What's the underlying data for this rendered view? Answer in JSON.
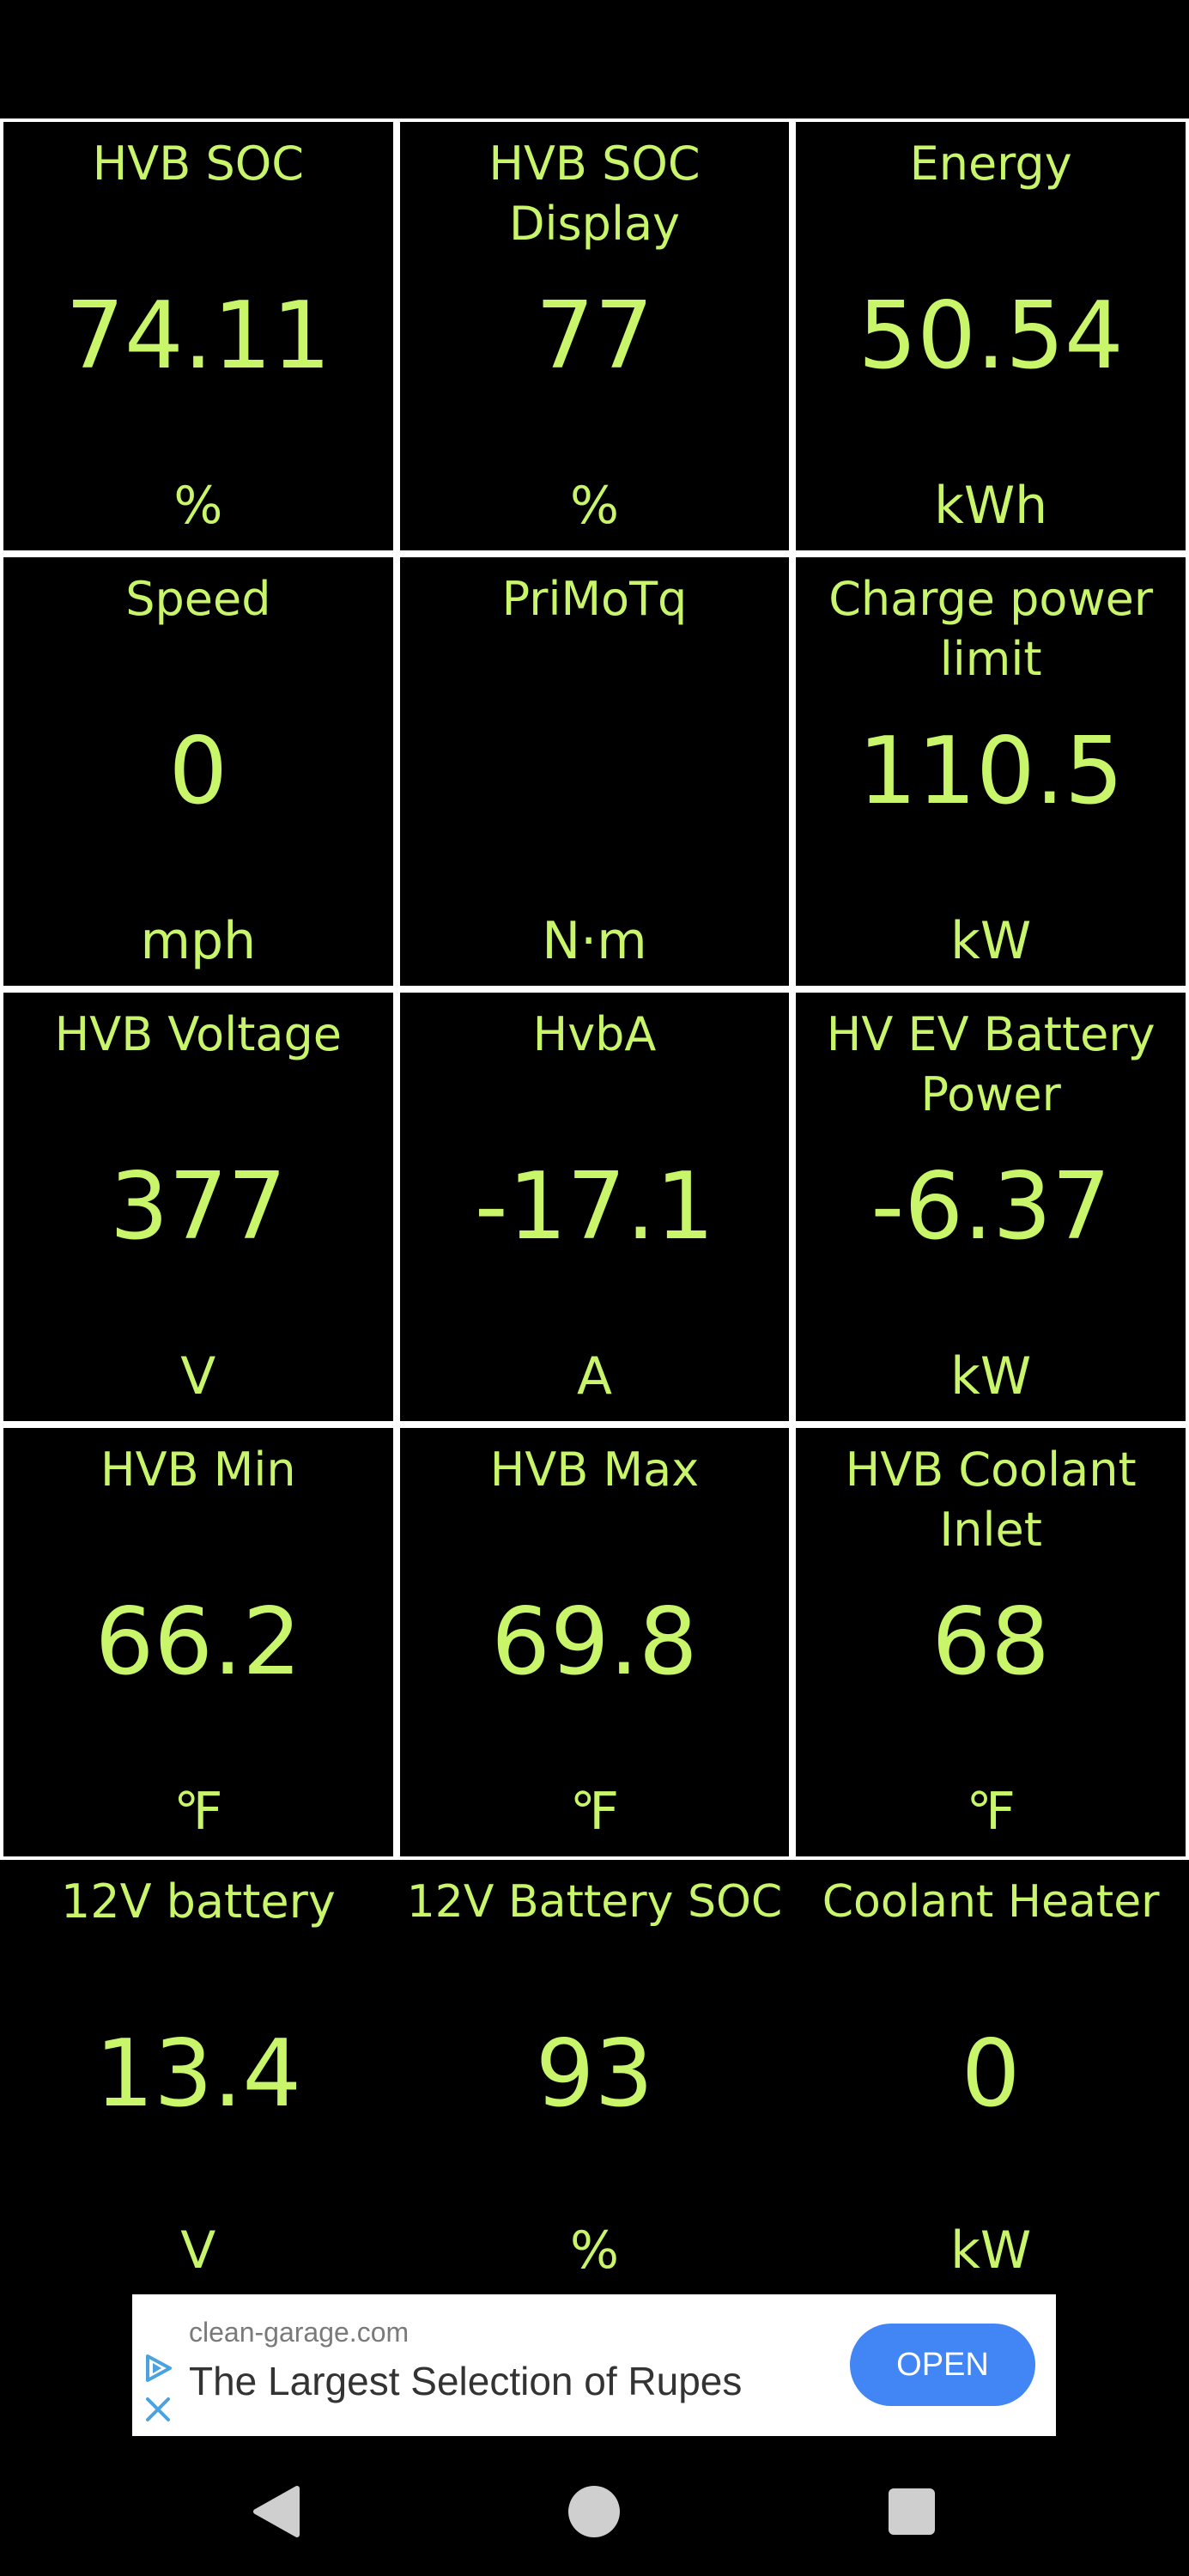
{
  "colors": {
    "background": "#000000",
    "text": "#c8f56a",
    "grid_border": "#ffffff",
    "ad_button": "#4285f4",
    "nav_icon": "#cfcfcf"
  },
  "tiles": [
    {
      "label": "HVB SOC",
      "value": "74.11",
      "unit": "%"
    },
    {
      "label": "HVB SOC Display",
      "value": "77",
      "unit": "%"
    },
    {
      "label": "Energy",
      "value": "50.54",
      "unit": "kWh"
    },
    {
      "label": "Speed",
      "value": "0",
      "unit": "mph"
    },
    {
      "label": "PriMoTq",
      "value": "",
      "unit": "N·m"
    },
    {
      "label": "Charge power limit",
      "value": "110.5",
      "unit": "kW"
    },
    {
      "label": "HVB Voltage",
      "value": "377",
      "unit": "V"
    },
    {
      "label": "HvbA",
      "value": "-17.1",
      "unit": "A"
    },
    {
      "label": "HV EV Battery Power",
      "value": "-6.37",
      "unit": "kW"
    },
    {
      "label": "HVB Min",
      "value": "66.2",
      "unit": "℉"
    },
    {
      "label": "HVB Max",
      "value": "69.8",
      "unit": "℉"
    },
    {
      "label": "HVB Coolant Inlet",
      "value": "68",
      "unit": "℉"
    },
    {
      "label": "12V battery",
      "value": "13.4",
      "unit": "V"
    },
    {
      "label": "12V Battery SOC",
      "value": "93",
      "unit": "%"
    },
    {
      "label": "Coolant Heater",
      "value": "0",
      "unit": "kW"
    }
  ],
  "ad": {
    "domain": "clean-garage.com",
    "title": "The Largest Selection of Rupes",
    "button_label": "OPEN",
    "icons": [
      "ad-choices-icon",
      "close-icon"
    ]
  },
  "navbar": {
    "icons": [
      "back-icon",
      "home-icon",
      "recents-icon"
    ]
  }
}
